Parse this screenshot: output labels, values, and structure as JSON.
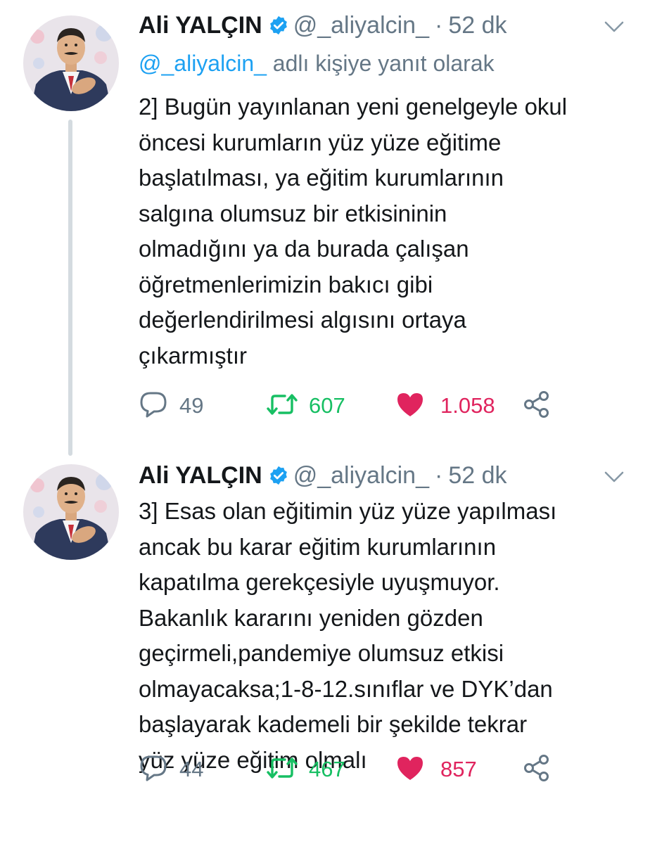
{
  "colors": {
    "text": "#14171a",
    "muted": "#657786",
    "link": "#1da1f2",
    "retweet": "#17bf63",
    "like": "#e0245e",
    "thread_line": "#d4dbe0"
  },
  "tweets": [
    {
      "author_name": "Ali YALÇIN",
      "verified": true,
      "handle": "@_aliyalcin_",
      "separator": "·",
      "time": "52 dk",
      "reply_to_handle": "@_aliyalcin_",
      "reply_to_suffix": "adlı kişiye yanıt olarak",
      "text_lines": [
        "2] Bugün yayınlanan yeni genelgeyle okul",
        "öncesi kurumların yüz yüze eğitime",
        "başlatılması, ya eğitim kurumlarının",
        "salgına  olumsuz bir etkisininin",
        "olmadığını ya da burada çalışan",
        "öğretmenlerimizin bakıcı gibi",
        "değerlendirilmesi algısını ortaya",
        "çıkarmıştır"
      ],
      "replies": "49",
      "retweets": "607",
      "likes": "1.058",
      "liked": true
    },
    {
      "author_name": "Ali YALÇIN",
      "verified": true,
      "handle": "@_aliyalcin_",
      "separator": "·",
      "time": "52 dk",
      "text_lines": [
        "3] Esas olan eğitimin yüz yüze  yapılması",
        "ancak bu karar eğitim kurumlarının",
        "kapatılma gerekçesiyle uyuşmuyor.",
        "Bakanlık kararını yeniden gözden",
        "geçirmeli,pandemiye olumsuz etkisi",
        "olmayacaksa;1-8-12.sınıflar ve DYK’dan",
        "başlayarak kademeli bir şekilde tekrar",
        "yüz yüze eğitim olmalı"
      ],
      "replies": "44",
      "retweets": "467",
      "likes": "857",
      "liked": true
    }
  ]
}
